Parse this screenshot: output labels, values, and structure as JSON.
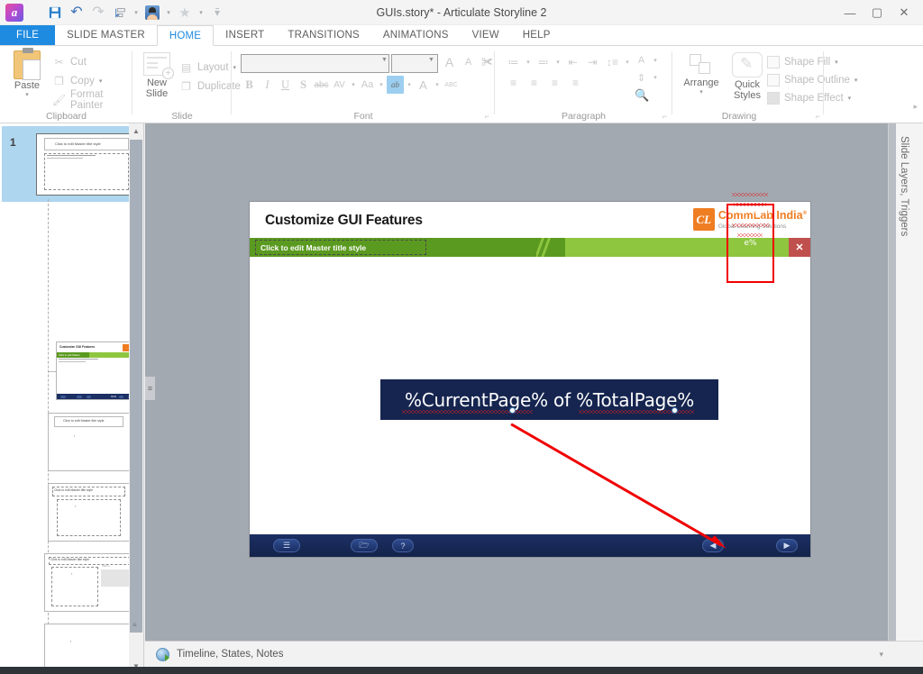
{
  "window": {
    "title": "GUIs.story* - Articulate Storyline 2",
    "app_icon": "a",
    "minimize": "—",
    "maximize": "▢",
    "close": "✕",
    "help": "?"
  },
  "quick_access": [
    {
      "name": "save",
      "glyph": "💾"
    },
    {
      "name": "undo",
      "glyph": "↶"
    },
    {
      "name": "redo",
      "glyph": "↷"
    },
    {
      "name": "align",
      "glyph": "⊨"
    },
    {
      "name": "player",
      "glyph": ""
    },
    {
      "name": "favorites",
      "glyph": "★"
    },
    {
      "name": "customize",
      "glyph": "▾"
    }
  ],
  "tabs": [
    {
      "label": "FILE",
      "kind": "file"
    },
    {
      "label": "SLIDE MASTER",
      "kind": "normal"
    },
    {
      "label": "HOME",
      "kind": "active"
    },
    {
      "label": "INSERT",
      "kind": "normal"
    },
    {
      "label": "TRANSITIONS",
      "kind": "normal"
    },
    {
      "label": "ANIMATIONS",
      "kind": "normal"
    },
    {
      "label": "VIEW",
      "kind": "normal"
    },
    {
      "label": "HELP",
      "kind": "normal"
    }
  ],
  "ribbon": {
    "clipboard": {
      "group_label": "Clipboard",
      "paste": "Paste",
      "cut": "Cut",
      "copy": "Copy",
      "format_painter": "Format Painter",
      "cut_icon": "✂",
      "copy_icon": "❐",
      "painter_icon": "🖌"
    },
    "slide": {
      "group_label": "Slide",
      "new_slide_line1": "New",
      "new_slide_line2": "Slide",
      "layout": "Layout",
      "duplicate": "Duplicate",
      "layout_icon": "▤",
      "duplicate_icon": "❐"
    },
    "font": {
      "group_label": "Font",
      "font_name_value": "",
      "font_size_value": "",
      "grow_font": "A",
      "shrink_font": "A",
      "clear_format": "✀",
      "bold": "B",
      "italic": "I",
      "underline": "U",
      "strikethrough": "S",
      "small_caps": "abc",
      "character_spacing": "AV",
      "change_case": "Aa",
      "text_highlight": "ab",
      "font_color": "A",
      "spelling": "ABC"
    },
    "paragraph": {
      "group_label": "Paragraph",
      "bullets": "≔",
      "numbering": "≕",
      "decrease_indent": "⇤",
      "increase_indent": "⇥",
      "line_spacing": "↕≡",
      "text_direction": "A",
      "align_text": "⇕",
      "find_replace": "🔍",
      "align_left": "≡",
      "align_center": "≡",
      "align_right": "≡",
      "justify": "≡"
    },
    "drawing": {
      "group_label": "Drawing",
      "arrange": "Arrange",
      "quick_styles_line1": "Quick",
      "quick_styles_line2": "Styles",
      "shape_fill": "Shape Fill",
      "shape_outline": "Shape Outline",
      "shape_effect": "Shape Effect"
    },
    "overflow": "▸"
  },
  "slide_panel": {
    "selected_number": "1",
    "thumbnails": [
      {
        "name": "master-slide",
        "title": "Click to edit Master title style",
        "selected": true
      },
      {
        "name": "layout-title-content",
        "title": "",
        "selected": false
      },
      {
        "name": "layout-title-only",
        "title": "Click to edit Master title style",
        "selected": false
      },
      {
        "name": "layout-title-body",
        "title": "Click to edit Master title style",
        "selected": false
      },
      {
        "name": "layout-two-content",
        "title": "Click to edit Master title style",
        "selected": false
      },
      {
        "name": "layout-blank",
        "title": "",
        "selected": false
      }
    ]
  },
  "slide": {
    "title": "Customize GUI Features",
    "logo": {
      "mark": "CL",
      "name": "CommLab India",
      "registered": "®",
      "tagline": "Global Learning Solutions"
    },
    "master_title_placeholder": "Click to edit Master title style",
    "close_label": "✕",
    "textbox": {
      "text": "%CurrentPage% of %TotalPage%",
      "background_color": "#16254f",
      "text_color": "#ffffff"
    },
    "nav_bar": {
      "menu_icon": "☰",
      "resources_icon": "🗁",
      "help_icon": "?",
      "prev_icon": "◀",
      "next_icon": "▶",
      "background_color": "#1c2f63"
    },
    "pager": {
      "text": "%CurrentPage% of %TotalPage%",
      "selection_color": "#f00000"
    },
    "annotation": {
      "type": "red-arrow",
      "color": "#f00000"
    }
  },
  "right_panel": {
    "label": "Slide Layers, Triggers"
  },
  "status_bar": {
    "text": "Timeline, States, Notes",
    "expand_caret": "▾"
  }
}
